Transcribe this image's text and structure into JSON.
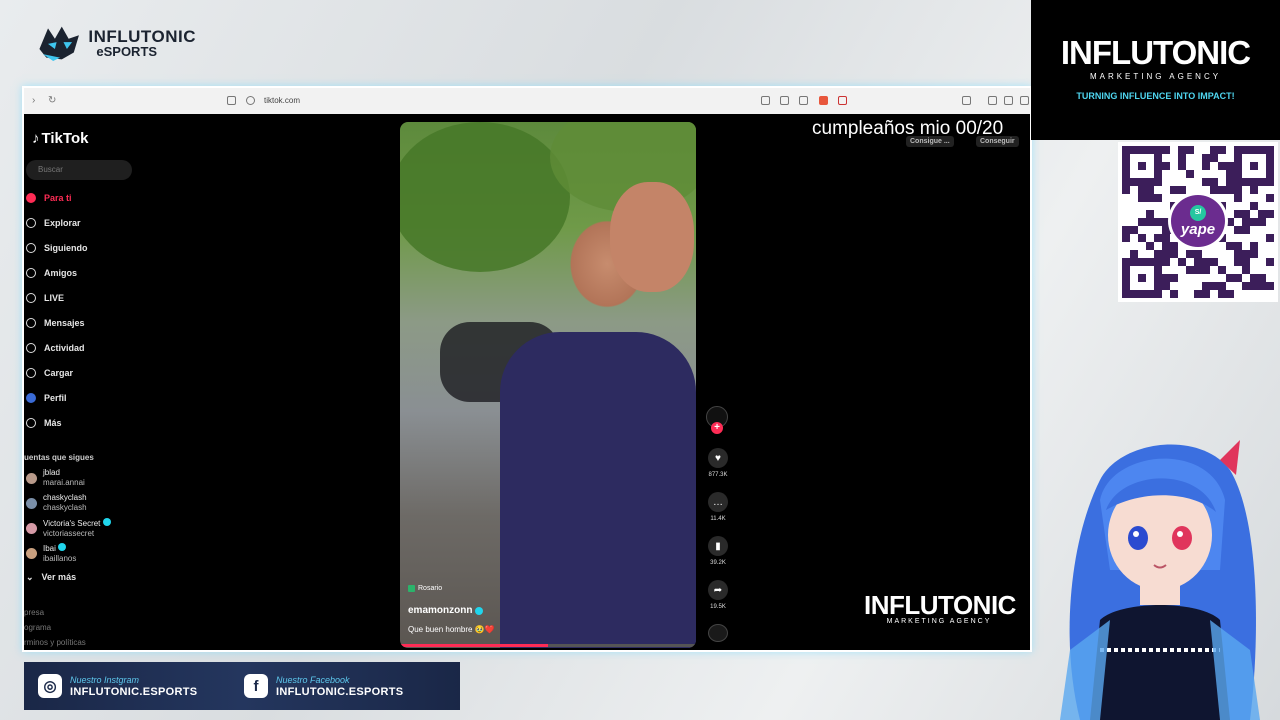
{
  "esports_logo": {
    "line1": "INFLUTONIC",
    "line2": "eSPORTS"
  },
  "browser": {
    "url": "tiktok.com"
  },
  "tiktok": {
    "logo": "TikTok",
    "search_placeholder": "Buscar",
    "nav": [
      {
        "label": "Para ti",
        "icon": "home-icon"
      },
      {
        "label": "Explorar",
        "icon": "compass-icon"
      },
      {
        "label": "Siguiendo",
        "icon": "following-icon"
      },
      {
        "label": "Amigos",
        "icon": "friends-icon"
      },
      {
        "label": "LIVE",
        "icon": "live-icon"
      },
      {
        "label": "Mensajes",
        "icon": "message-icon"
      },
      {
        "label": "Actividad",
        "icon": "activity-icon"
      },
      {
        "label": "Cargar",
        "icon": "upload-icon"
      },
      {
        "label": "Perfil",
        "icon": "profile-icon"
      },
      {
        "label": "Más",
        "icon": "more-icon"
      }
    ],
    "following_header": "uentas que sigues",
    "following": [
      {
        "name": "jblad",
        "handle": "marai.annai"
      },
      {
        "name": "chaskyclash",
        "handle": "chaskyclash"
      },
      {
        "name": "Victoria's Secret",
        "handle": "victoriassecret"
      },
      {
        "name": "Ibai",
        "handle": "ibaillanos"
      }
    ],
    "see_more": "Ver más",
    "footer": [
      "presa",
      "ograma",
      "rminos y políticas"
    ]
  },
  "video": {
    "location": "Rosario",
    "username": "emamonzonn",
    "caption": "Que buen hombre 🥹❤️",
    "likes": "877.3K",
    "comments": "11.4K",
    "saves": "39.2K",
    "shares": "19.5K"
  },
  "stream_title": "cumpleaños mio 00/20",
  "chips": [
    "Consigue ...",
    "Conseguir"
  ],
  "watermark": {
    "line1": "INFLUTONIC",
    "line2": "MARKETING AGENCY"
  },
  "agency": {
    "line1": "INFLUTONIC",
    "line2": "MARKETING AGENCY",
    "tagline": "TURNING INFLUENCE INTO IMPACT!"
  },
  "yape": {
    "label": "yape",
    "badge": "S/"
  },
  "social": {
    "instagram": {
      "caption": "Nuestro Instgram",
      "handle": "INFLUTONIC.ESPORTS"
    },
    "facebook": {
      "caption": "Nuestro Facebook",
      "handle": "INFLUTONIC.ESPORTS"
    }
  },
  "colors": {
    "tiktok_red": "#fe2c55",
    "accent_cyan": "#4fd6f0",
    "bar_navy": "#1c2a4a",
    "yape_purple": "#6b2c8f"
  }
}
